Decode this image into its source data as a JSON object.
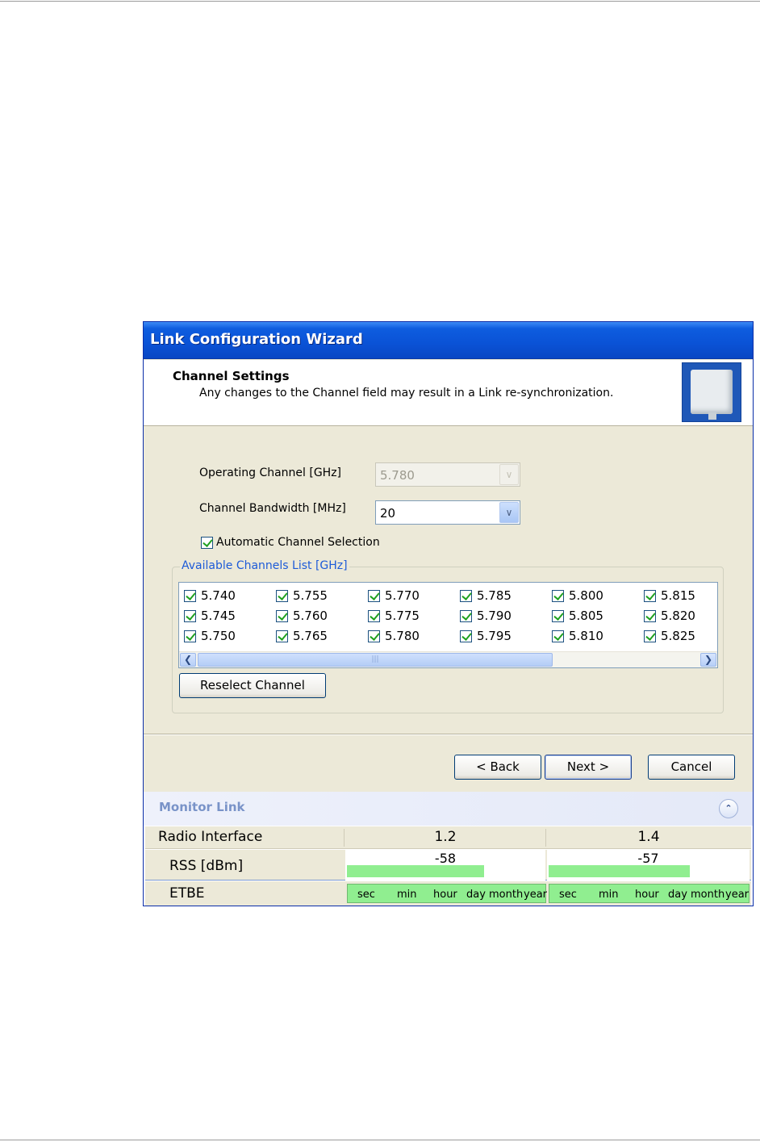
{
  "window": {
    "title": "Link Configuration Wizard"
  },
  "header": {
    "title": "Channel Settings",
    "subtitle": "Any changes to the Channel field may result in a Link re-synchronization."
  },
  "form": {
    "operating_channel": {
      "label": "Operating Channel [GHz]",
      "value": "5.780",
      "disabled": true
    },
    "channel_bandwidth": {
      "label": "Channel Bandwidth [MHz]",
      "value": "20"
    },
    "auto_channel": {
      "label": "Automatic Channel Selection",
      "checked": true
    }
  },
  "channels": {
    "legend": "Available Channels List [GHz]",
    "items": [
      "5.740",
      "5.745",
      "5.750",
      "5.755",
      "5.760",
      "5.765",
      "5.770",
      "5.775",
      "5.780",
      "5.785",
      "5.790",
      "5.795",
      "5.800",
      "5.805",
      "5.810",
      "5.815",
      "5.820",
      "5.825"
    ],
    "all_checked": true
  },
  "buttons": {
    "reselect": "Reselect Channel",
    "back": "< Back",
    "next": "Next >",
    "cancel": "Cancel"
  },
  "monitor": {
    "title": "Monitor Link",
    "col_label": "Radio Interface",
    "col1": "1.2",
    "col2": "1.4",
    "rss_label": "RSS [dBm]",
    "rss1": "-58",
    "rss2": "-57",
    "etbe_label": "ETBE",
    "etbe_units": [
      "sec",
      "min",
      "hour",
      "day",
      "month",
      "year"
    ],
    "bar_color": "#90ee90"
  }
}
